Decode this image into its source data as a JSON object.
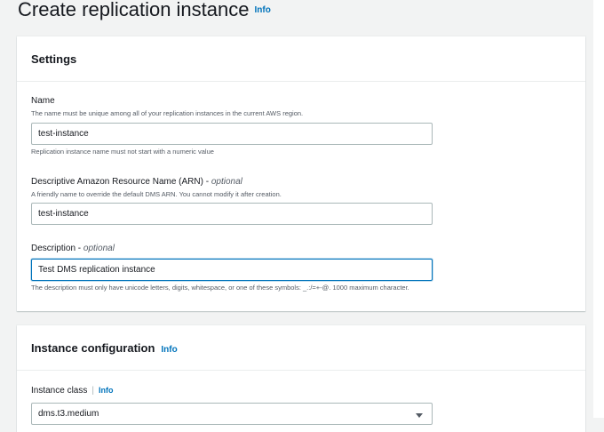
{
  "page": {
    "title": "Create replication instance",
    "title_info": "Info"
  },
  "settings": {
    "title": "Settings",
    "name": {
      "label": "Name",
      "description": "The name must be unique among all of your replication instances in the current AWS region.",
      "value": "test-instance",
      "hint": "Replication instance name must not start with a numeric value"
    },
    "arn": {
      "label": "Descriptive Amazon Resource Name (ARN) - ",
      "optional": "optional",
      "description": "A friendly name to override the default DMS ARN. You cannot modify it after creation.",
      "value": "test-instance"
    },
    "description": {
      "label": "Description - ",
      "optional": "optional",
      "value": "Test DMS replication instance",
      "hint": "The description must only have unicode letters, digits, whitespace, or one of these symbols: _.:/=+-@. 1000 maximum character."
    }
  },
  "instance_config": {
    "title": "Instance configuration",
    "info": "Info",
    "instance_class": {
      "label": "Instance class",
      "info": "Info",
      "value": "dms.t3.medium"
    }
  }
}
